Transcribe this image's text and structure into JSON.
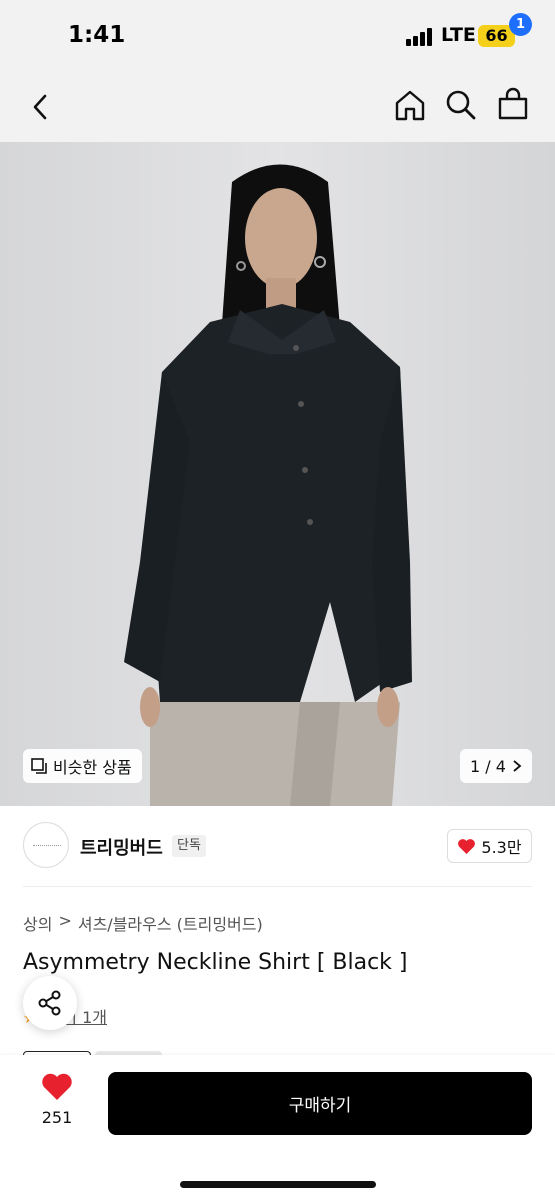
{
  "status_bar": {
    "time": "1:41",
    "network": "LTE",
    "battery": "66",
    "battery_color": "#f5d01a"
  },
  "nav": {
    "back_icon": "chevron-left-icon",
    "home_icon": "home-icon",
    "search_icon": "search-icon",
    "bag_icon": "shopping-bag-icon",
    "bag_count": "1",
    "badge_color": "#1f6fff"
  },
  "hero": {
    "similar_label": "비슷한 상품",
    "page_counter": "1 / 4"
  },
  "brand": {
    "name": "트리밍버드",
    "tag": "단독",
    "likes": "5.3만"
  },
  "product": {
    "breadcrumb": [
      "상의",
      "셔츠/블라우스 (트리밍버드)"
    ],
    "title": "Asymmetry Neckline Shirt [ Black ]",
    "review_label": "후기 1개"
  },
  "bottom_bar": {
    "wish_count": "251",
    "buy_label": "구매하기",
    "heart_color": "#e8212f"
  }
}
